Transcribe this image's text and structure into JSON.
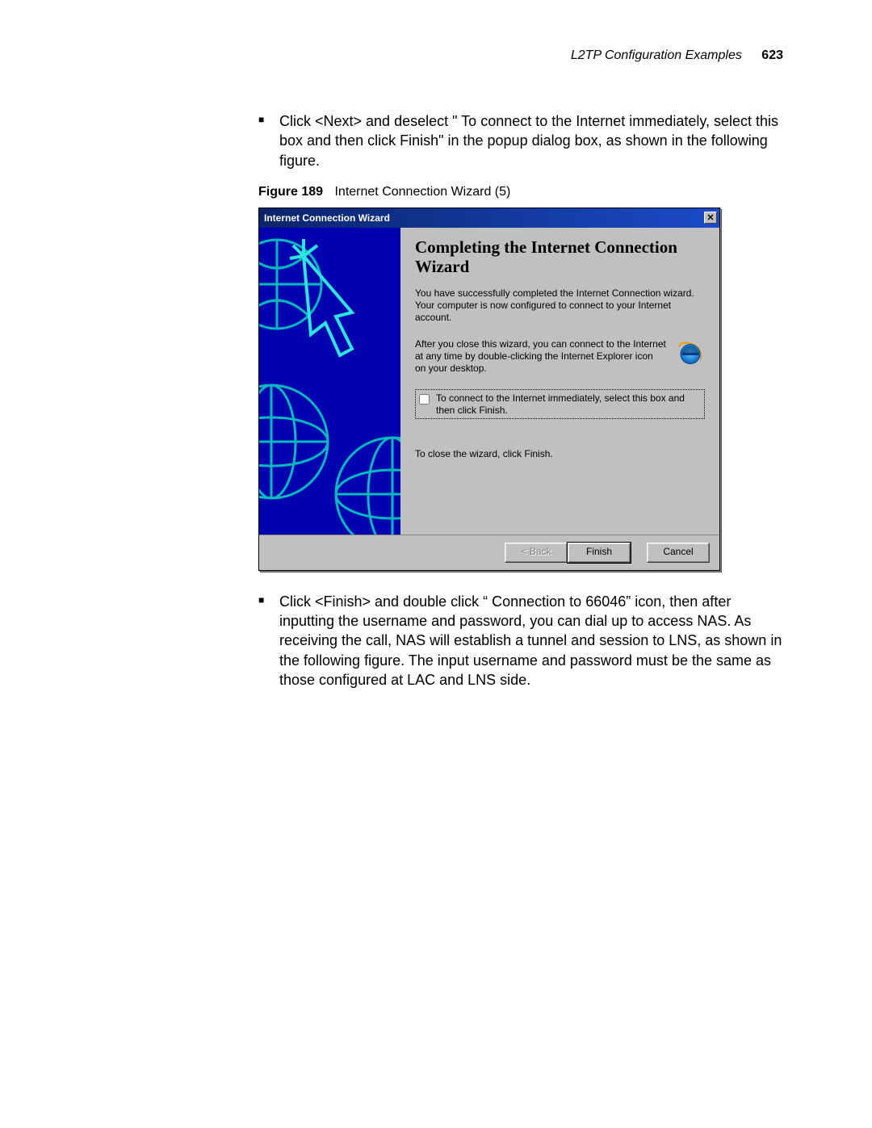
{
  "header": {
    "section_title": "L2TP Configuration Examples",
    "page_number": "623"
  },
  "body": {
    "bullet1": "Click <Next> and deselect \" To connect to the Internet immediately, select this box and then click Finish\"  in the popup dialog box, as shown in the following figure.",
    "bullet2": "Click <Finish> and double click “ Connection to 66046”  icon, then after inputting the username and password, you can dial up to access NAS. As receiving the call, NAS will establish a tunnel and session to LNS, as shown in the following figure. The input username and password must be the same as those configured at LAC and LNS side."
  },
  "figure": {
    "label": "Figure 189",
    "title": "Internet Connection Wizard (5)"
  },
  "dialog": {
    "title": "Internet Connection Wizard",
    "heading": "Completing the Internet Connection Wizard",
    "para_success": "You have successfully completed the Internet Connection wizard. Your computer is now configured to connect to your Internet account.",
    "para_after": "After you close this wizard, you can connect to the Internet at any time by double-clicking the Internet Explorer icon on your desktop.",
    "checkbox_label": "To connect to the Internet immediately, select this box and then click Finish.",
    "close_hint": "To close the wizard, click Finish.",
    "buttons": {
      "back": "< Back",
      "finish": "Finish",
      "cancel": "Cancel"
    }
  }
}
